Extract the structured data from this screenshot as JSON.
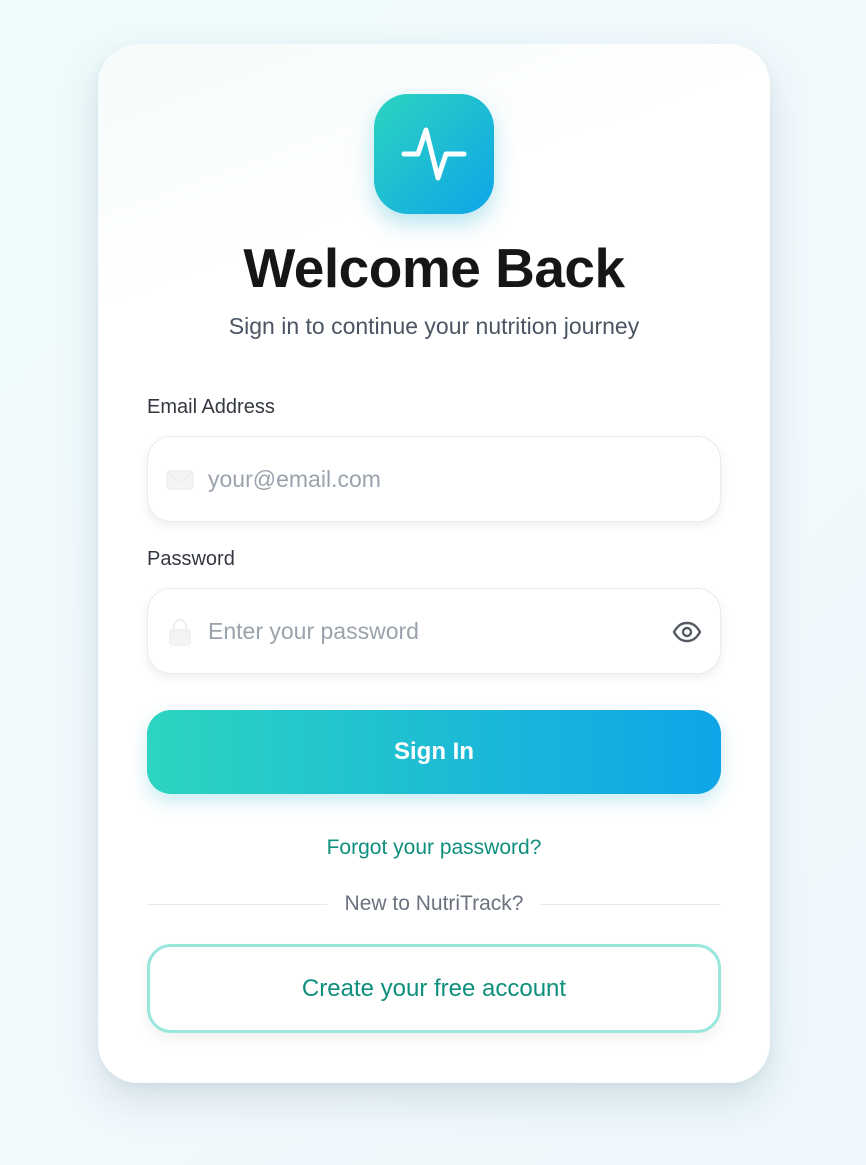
{
  "logo": {
    "icon": "activity-pulse-icon",
    "gradient_start": "#2dd4bf",
    "gradient_end": "#0ea5e9"
  },
  "header": {
    "title": "Welcome Back",
    "subtitle": "Sign in to continue your nutrition journey"
  },
  "email": {
    "label": "Email Address",
    "placeholder": "your@email.com",
    "value": "",
    "icon": "mail-icon"
  },
  "password": {
    "label": "Password",
    "placeholder": "Enter your password",
    "value": "",
    "icon": "lock-icon",
    "toggle_icon": "eye-icon"
  },
  "actions": {
    "signin_label": "Sign In",
    "forgot_label": "Forgot your password?",
    "divider_text": "New to NutriTrack?",
    "create_label": "Create your free account"
  },
  "colors": {
    "accent_teal": "#2dd4bf",
    "accent_blue": "#0ea5e9",
    "link": "#0f8f7d",
    "outline_border": "#99e6dc"
  }
}
